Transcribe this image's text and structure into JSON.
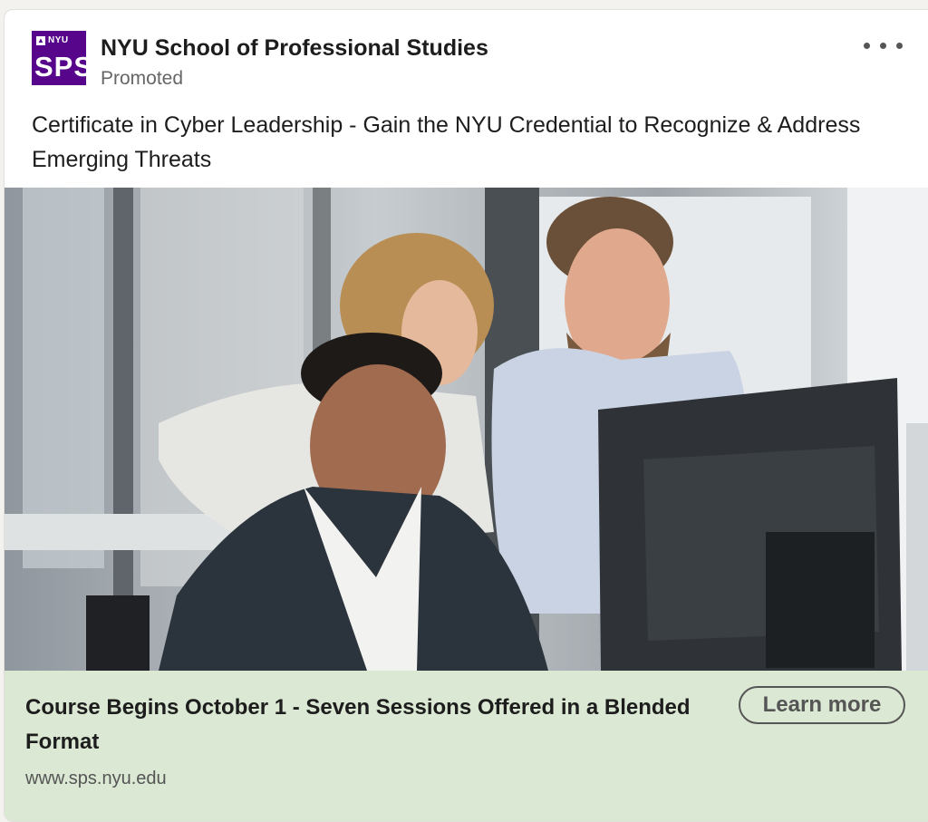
{
  "advertiser": {
    "logo_top_text": "NYU",
    "logo_main_text": "SPS",
    "name": "NYU School of Professional Studies",
    "label": "Promoted"
  },
  "menu": {
    "icon": "more-horizontal-icon"
  },
  "post": {
    "headline": "Certificate in Cyber Leadership - Gain the NYU Credential to Recognize & Address Emerging Threats"
  },
  "cta": {
    "title": "Course Begins October 1 - Seven Sessions Offered in a Blended Format",
    "url": "www.sps.nyu.edu",
    "button_label": "Learn more"
  },
  "colors": {
    "brand_purple": "#57068c",
    "cta_background": "#dbe8d3"
  }
}
